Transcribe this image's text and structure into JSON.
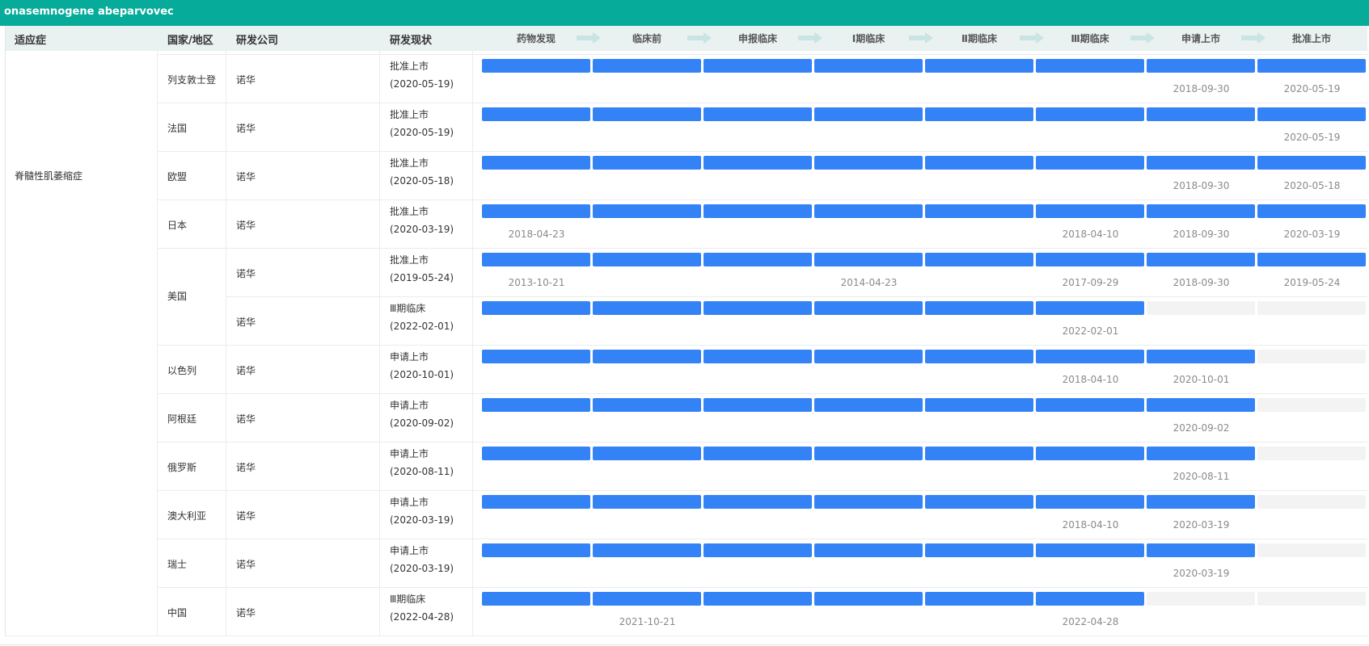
{
  "title": "onasemnogene abeparvovec",
  "headers": {
    "indication": "适应症",
    "region": "国家/地区",
    "company": "研发公司",
    "status": "研发现状"
  },
  "stages": [
    "药物发现",
    "临床前",
    "申报临床",
    "Ⅰ期临床",
    "Ⅱ期临床",
    "Ⅲ期临床",
    "申请上市",
    "批准上市"
  ],
  "indication": "脊髓性肌萎缩症",
  "colors": {
    "header_bar": "#07ab9a",
    "stage_done": "#3483f6",
    "stage_pending": "#f3f3f3"
  },
  "rows": [
    {
      "region": "列支敦士登",
      "company": "诺华",
      "status": "批准上市",
      "status_date": "(2020-05-19)",
      "completed": 8,
      "dates": [
        "",
        "",
        "",
        "",
        "",
        "",
        "2018-09-30",
        "2020-05-19"
      ]
    },
    {
      "region": "法国",
      "company": "诺华",
      "status": "批准上市",
      "status_date": "(2020-05-19)",
      "completed": 8,
      "dates": [
        "",
        "",
        "",
        "",
        "",
        "",
        "",
        "2020-05-19"
      ]
    },
    {
      "region": "欧盟",
      "company": "诺华",
      "status": "批准上市",
      "status_date": "(2020-05-18)",
      "completed": 8,
      "dates": [
        "",
        "",
        "",
        "",
        "",
        "",
        "2018-09-30",
        "2020-05-18"
      ]
    },
    {
      "region": "日本",
      "company": "诺华",
      "status": "批准上市",
      "status_date": "(2020-03-19)",
      "completed": 8,
      "dates": [
        "2018-04-23",
        "",
        "",
        "",
        "",
        "2018-04-10",
        "2018-09-30",
        "2020-03-19"
      ]
    },
    {
      "region": "美国",
      "company": "诺华",
      "status": "批准上市",
      "status_date": "(2019-05-24)",
      "completed": 8,
      "dates": [
        "2013-10-21",
        "",
        "",
        "2014-04-23",
        "",
        "2017-09-29",
        "2018-09-30",
        "2019-05-24"
      ]
    },
    {
      "region": "",
      "company": "诺华",
      "status": "Ⅲ期临床",
      "status_date": "(2022-02-01)",
      "completed": 6,
      "dates": [
        "",
        "",
        "",
        "",
        "",
        "2022-02-01",
        "",
        ""
      ]
    },
    {
      "region": "以色列",
      "company": "诺华",
      "status": "申请上市",
      "status_date": "(2020-10-01)",
      "completed": 7,
      "dates": [
        "",
        "",
        "",
        "",
        "",
        "2018-04-10",
        "2020-10-01",
        ""
      ]
    },
    {
      "region": "阿根廷",
      "company": "诺华",
      "status": "申请上市",
      "status_date": "(2020-09-02)",
      "completed": 7,
      "dates": [
        "",
        "",
        "",
        "",
        "",
        "",
        "2020-09-02",
        ""
      ]
    },
    {
      "region": "俄罗斯",
      "company": "诺华",
      "status": "申请上市",
      "status_date": "(2020-08-11)",
      "completed": 7,
      "dates": [
        "",
        "",
        "",
        "",
        "",
        "",
        "2020-08-11",
        ""
      ]
    },
    {
      "region": "澳大利亚",
      "company": "诺华",
      "status": "申请上市",
      "status_date": "(2020-03-19)",
      "completed": 7,
      "dates": [
        "",
        "",
        "",
        "",
        "",
        "2018-04-10",
        "2020-03-19",
        ""
      ]
    },
    {
      "region": "瑞士",
      "company": "诺华",
      "status": "申请上市",
      "status_date": "(2020-03-19)",
      "completed": 7,
      "dates": [
        "",
        "",
        "",
        "",
        "",
        "",
        "2020-03-19",
        ""
      ]
    },
    {
      "region": "中国",
      "company": "诺华",
      "status": "Ⅲ期临床",
      "status_date": "(2022-04-28)",
      "completed": 6,
      "dates": [
        "",
        "2021-10-21",
        "",
        "",
        "",
        "2022-04-28",
        "",
        ""
      ]
    }
  ]
}
